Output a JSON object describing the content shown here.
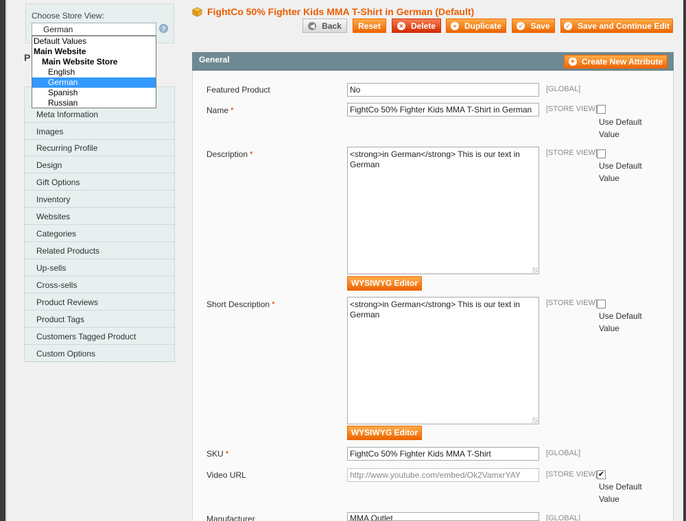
{
  "store": {
    "label": "Choose Store View:",
    "selected": "German",
    "help_icon": "help-icon",
    "options": [
      {
        "label": "Default Values",
        "kind": "default"
      },
      {
        "label": "Main Website",
        "kind": "website"
      },
      {
        "label": "Main Website Store",
        "kind": "store"
      },
      {
        "label": "English",
        "kind": "view"
      },
      {
        "label": "German",
        "kind": "view",
        "selected": true
      },
      {
        "label": "Spanish",
        "kind": "view"
      },
      {
        "label": "Russian",
        "kind": "view"
      }
    ]
  },
  "sidebar": {
    "heading": "P",
    "items": [
      {
        "label": "Meta Information"
      },
      {
        "label": "Images"
      },
      {
        "label": "Recurring Profile"
      },
      {
        "label": "Design"
      },
      {
        "label": "Gift Options"
      },
      {
        "label": "Inventory"
      },
      {
        "label": "Websites"
      },
      {
        "label": "Categories"
      },
      {
        "label": "Related Products"
      },
      {
        "label": "Up-sells"
      },
      {
        "label": "Cross-sells"
      },
      {
        "label": "Product Reviews"
      },
      {
        "label": "Product Tags"
      },
      {
        "label": "Customers Tagged Product"
      },
      {
        "label": "Custom Options"
      }
    ]
  },
  "header": {
    "title": "FightCo 50% Fighter Kids MMA T-Shirt in German (Default)",
    "title_icon": "product-box-icon",
    "buttons": {
      "back": "Back",
      "reset": "Reset",
      "delete": "Delete",
      "duplicate": "Duplicate",
      "save": "Save",
      "save_continue": "Save and Continue Edit"
    }
  },
  "panel": {
    "title": "General",
    "create_attribute": "Create New Attribute"
  },
  "form": {
    "use_default_label": "Use Default Value",
    "wysiwyg_label": "WYSIWYG Editor",
    "featured": {
      "label": "Featured Product",
      "value": "No",
      "scope": "[GLOBAL]"
    },
    "name": {
      "label": "Name",
      "required": "*",
      "value": "FightCo 50% Fighter Kids MMA T-Shirt in German",
      "scope": "[STORE VIEW]",
      "use_default": false
    },
    "description": {
      "label": "Description",
      "required": "*",
      "value": "<strong>in German</strong> This is our text in German",
      "scope": "[STORE VIEW]",
      "use_default": false
    },
    "short_description": {
      "label": "Short Description",
      "required": "*",
      "value": "<strong>in German</strong> This is our text in German",
      "scope": "[STORE VIEW]",
      "use_default": false
    },
    "sku": {
      "label": "SKU",
      "required": "*",
      "value": "FightCo 50% Fighter Kids MMA T-Shirt",
      "scope": "[GLOBAL]"
    },
    "video_url": {
      "label": "Video URL",
      "value": "http://www.youtube.com/embed/Ok2VamxrYAY",
      "scope": "[STORE VIEW]",
      "use_default": true
    },
    "manufacturer": {
      "label": "Manufacturer",
      "value": "MMA Outlet",
      "scope": "[GLOBAL]"
    }
  },
  "colors": {
    "accent": "#eb5e00",
    "button": "#ed6502",
    "delete": "#d22c00",
    "panel_header": "#6f8992",
    "sidebar_bg": "#e7efef",
    "dropdown_highlight": "#3399ff"
  }
}
